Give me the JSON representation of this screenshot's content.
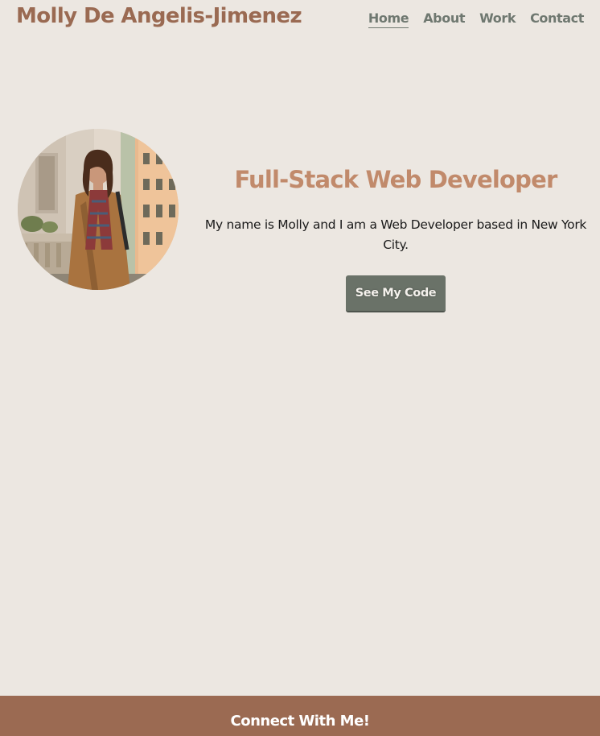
{
  "header": {
    "site_title": "Molly De Angelis-Jimenez",
    "nav": [
      {
        "label": "Home",
        "active": true
      },
      {
        "label": "About",
        "active": false
      },
      {
        "label": "Work",
        "active": false
      },
      {
        "label": "Contact",
        "active": false
      }
    ]
  },
  "hero": {
    "heading": "Full-Stack Web Developer",
    "description": "My name is Molly and I am a Web Developer based in New York City.",
    "cta_label": "See My Code"
  },
  "footer": {
    "title": "Connect With Me!"
  },
  "colors": {
    "background": "#ece7e1",
    "brand": "#9a6a52",
    "accent": "#c18a6b",
    "nav": "#6f7870",
    "button": "#6a7268",
    "footer": "#9b6a52"
  }
}
